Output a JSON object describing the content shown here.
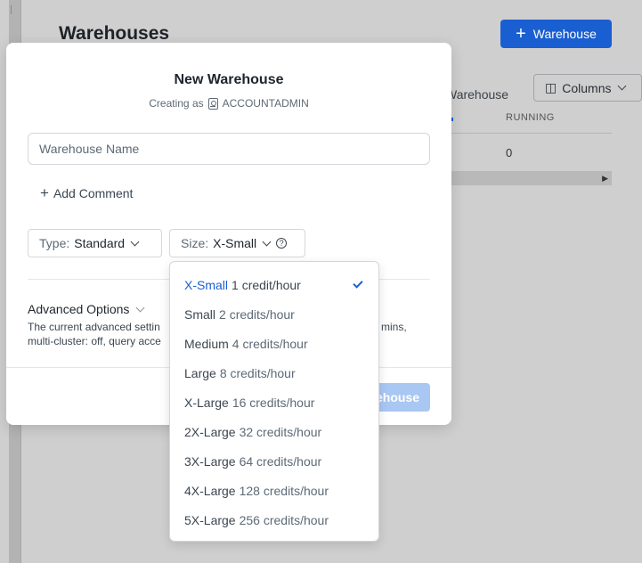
{
  "background": {
    "page_title": "Warehouses",
    "new_button_label": "Warehouse",
    "filter_label": "Warehouse",
    "columns_label": "Columns",
    "column_header": "RUNNING",
    "cell_value": "0"
  },
  "modal": {
    "title": "New Warehouse",
    "creating_as_label": "Creating as",
    "role": "ACCOUNTADMIN",
    "name_placeholder": "Warehouse Name",
    "add_comment_label": "Add Comment",
    "type_key": "Type:",
    "type_value": "Standard",
    "size_key": "Size:",
    "size_value": "X-Small",
    "advanced_title": "Advanced Options",
    "advanced_desc_line1_start": "The current advanced settin",
    "advanced_desc_line1_end": "mins,",
    "advanced_desc_line2": "multi-cluster: off, query acce",
    "create_button_label": "ehouse"
  },
  "size_dropdown": {
    "selected": "X-Small",
    "options": [
      {
        "name": "X-Small",
        "credits": "1 credit/hour"
      },
      {
        "name": "Small",
        "credits": "2 credits/hour"
      },
      {
        "name": "Medium",
        "credits": "4 credits/hour"
      },
      {
        "name": "Large",
        "credits": "8 credits/hour"
      },
      {
        "name": "X-Large",
        "credits": "16 credits/hour"
      },
      {
        "name": "2X-Large",
        "credits": "32 credits/hour"
      },
      {
        "name": "3X-Large",
        "credits": "64 credits/hour"
      },
      {
        "name": "4X-Large",
        "credits": "128 credits/hour"
      },
      {
        "name": "5X-Large",
        "credits": "256 credits/hour"
      }
    ]
  },
  "colors": {
    "accent": "#1a5fd1",
    "accent_disabled": "#a9c7f3",
    "overlay": "#cfcfcf"
  }
}
